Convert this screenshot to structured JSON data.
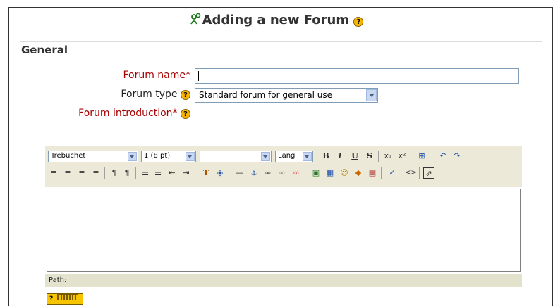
{
  "page": {
    "title": "Adding a new Forum"
  },
  "fieldset": {
    "legend": "General"
  },
  "form": {
    "forum_name_label": "Forum name*",
    "forum_name_value": "",
    "forum_type_label": "Forum type",
    "forum_type_value": "Standard forum for general use",
    "forum_intro_label": "Forum introduction*"
  },
  "editor": {
    "font_value": "Trebuchet",
    "size_value": "1 (8 pt)",
    "format_value": "",
    "lang_value": "Lang",
    "path_label": "Path:",
    "toolbar_row1": [
      "B",
      "I",
      "U",
      "S",
      "x₂",
      "x²",
      "⊞",
      "↶",
      "↷"
    ],
    "toolbar_row2": [
      "≡",
      "≡",
      "≡",
      "≡",
      "¶",
      "¶",
      "☰",
      "☰",
      "⇤",
      "⇥",
      "T",
      "◈",
      "—",
      "⚓",
      "∞",
      "∞",
      "∞",
      "▣",
      "▦",
      "☺",
      "◆",
      "▤",
      "✓",
      "<>",
      "⇗"
    ]
  },
  "help_glyph": "?",
  "kbd_help_label": "?"
}
